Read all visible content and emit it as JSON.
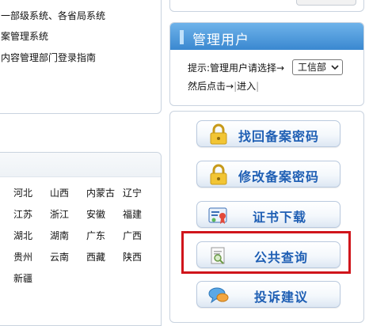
{
  "left_links": [
    "一部级系统、各省局系统",
    "案管理系统",
    "内容管理部门登录指南"
  ],
  "provinces": [
    "河北",
    "山西",
    "内蒙古",
    "辽宁",
    "江苏",
    "浙江",
    "安徽",
    "福建",
    "湖北",
    "湖南",
    "广东",
    "广西",
    "贵州",
    "云南",
    "西藏",
    "陕西",
    "新疆"
  ],
  "manager": {
    "title": "管理用户",
    "hint": "提示:管理用户请选择→",
    "selected": "工信部",
    "then": "然后点击→",
    "enter": "进入"
  },
  "services": [
    {
      "label": "找回备案密码",
      "icon": "lock-icon"
    },
    {
      "label": "修改备案密码",
      "icon": "lock-icon"
    },
    {
      "label": "证书下载",
      "icon": "certificate-icon"
    },
    {
      "label": "公共查询",
      "icon": "search-document-icon"
    },
    {
      "label": "投诉建议",
      "icon": "chat-bubble-icon"
    }
  ],
  "colors": {
    "header_blue": "#3a88d0",
    "button_text": "#1f5fb4",
    "highlight": "#d0151b"
  }
}
